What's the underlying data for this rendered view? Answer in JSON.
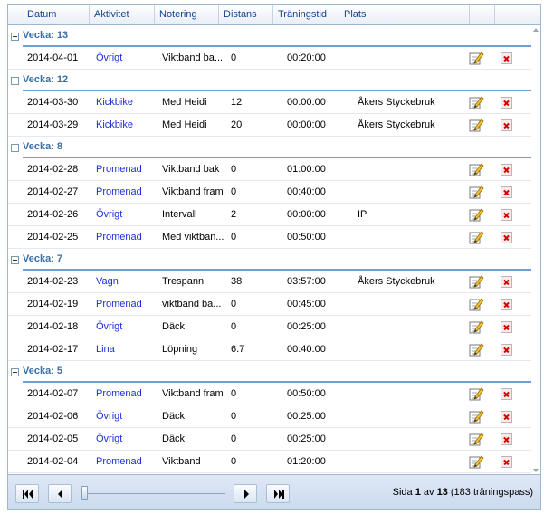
{
  "columns": [
    "Datum",
    "Aktivitet",
    "Notering",
    "Distans",
    "Träningstid",
    "Plats"
  ],
  "groups": [
    {
      "title": "Vecka: 13",
      "rows": [
        {
          "date": "2014-04-01",
          "activity": "Övrigt",
          "note": "Viktband ba...",
          "distance": "0",
          "time": "00:20:00",
          "place": ""
        }
      ]
    },
    {
      "title": "Vecka: 12",
      "rows": [
        {
          "date": "2014-03-30",
          "activity": "Kickbike",
          "note": "Med Heidi",
          "distance": "12",
          "time": "00:00:00",
          "place": "Åkers Styckebruk"
        },
        {
          "date": "2014-03-29",
          "activity": "Kickbike",
          "note": "Med Heidi",
          "distance": "20",
          "time": "00:00:00",
          "place": "Åkers Styckebruk"
        }
      ]
    },
    {
      "title": "Vecka: 8",
      "rows": [
        {
          "date": "2014-02-28",
          "activity": "Promenad",
          "note": "Viktband bak",
          "distance": "0",
          "time": "01:00:00",
          "place": ""
        },
        {
          "date": "2014-02-27",
          "activity": "Promenad",
          "note": "Viktband fram",
          "distance": "0",
          "time": "00:40:00",
          "place": ""
        },
        {
          "date": "2014-02-26",
          "activity": "Övrigt",
          "note": "Intervall",
          "distance": "2",
          "time": "00:00:00",
          "place": "IP"
        },
        {
          "date": "2014-02-25",
          "activity": "Promenad",
          "note": "Med viktban...",
          "distance": "0",
          "time": "00:50:00",
          "place": ""
        }
      ]
    },
    {
      "title": "Vecka: 7",
      "rows": [
        {
          "date": "2014-02-23",
          "activity": "Vagn",
          "note": "Trespann",
          "distance": "38",
          "time": "03:57:00",
          "place": "Åkers Styckebruk"
        },
        {
          "date": "2014-02-19",
          "activity": "Promenad",
          "note": "viktband ba...",
          "distance": "0",
          "time": "00:45:00",
          "place": ""
        },
        {
          "date": "2014-02-18",
          "activity": "Övrigt",
          "note": "Däck",
          "distance": "0",
          "time": "00:25:00",
          "place": ""
        },
        {
          "date": "2014-02-17",
          "activity": "Lina",
          "note": "Löpning",
          "distance": "6.7",
          "time": "00:40:00",
          "place": ""
        }
      ]
    },
    {
      "title": "Vecka: 5",
      "rows": [
        {
          "date": "2014-02-07",
          "activity": "Promenad",
          "note": "Viktband fram",
          "distance": "0",
          "time": "00:50:00",
          "place": ""
        },
        {
          "date": "2014-02-06",
          "activity": "Övrigt",
          "note": "Däck",
          "distance": "0",
          "time": "00:25:00",
          "place": ""
        },
        {
          "date": "2014-02-05",
          "activity": "Övrigt",
          "note": "Däck",
          "distance": "0",
          "time": "00:25:00",
          "place": ""
        },
        {
          "date": "2014-02-04",
          "activity": "Promenad",
          "note": "Viktband",
          "distance": "0",
          "time": "01:20:00",
          "place": ""
        }
      ]
    }
  ],
  "pager": {
    "prefix": "Sida ",
    "current": "1",
    "middle": " av ",
    "total": "13",
    "suffix": " (183 träningspass)",
    "slider_fraction": 0
  },
  "icons": {
    "first": "first-page-icon",
    "prev": "previous-page-icon",
    "next": "next-page-icon",
    "last": "last-page-icon",
    "edit": "edit-icon",
    "delete": "delete-icon"
  },
  "colors": {
    "group_title": "#3a6ea5",
    "activity_link": "#1b2fd6",
    "header_text": "#15428b",
    "delete_x": "#d40000"
  }
}
